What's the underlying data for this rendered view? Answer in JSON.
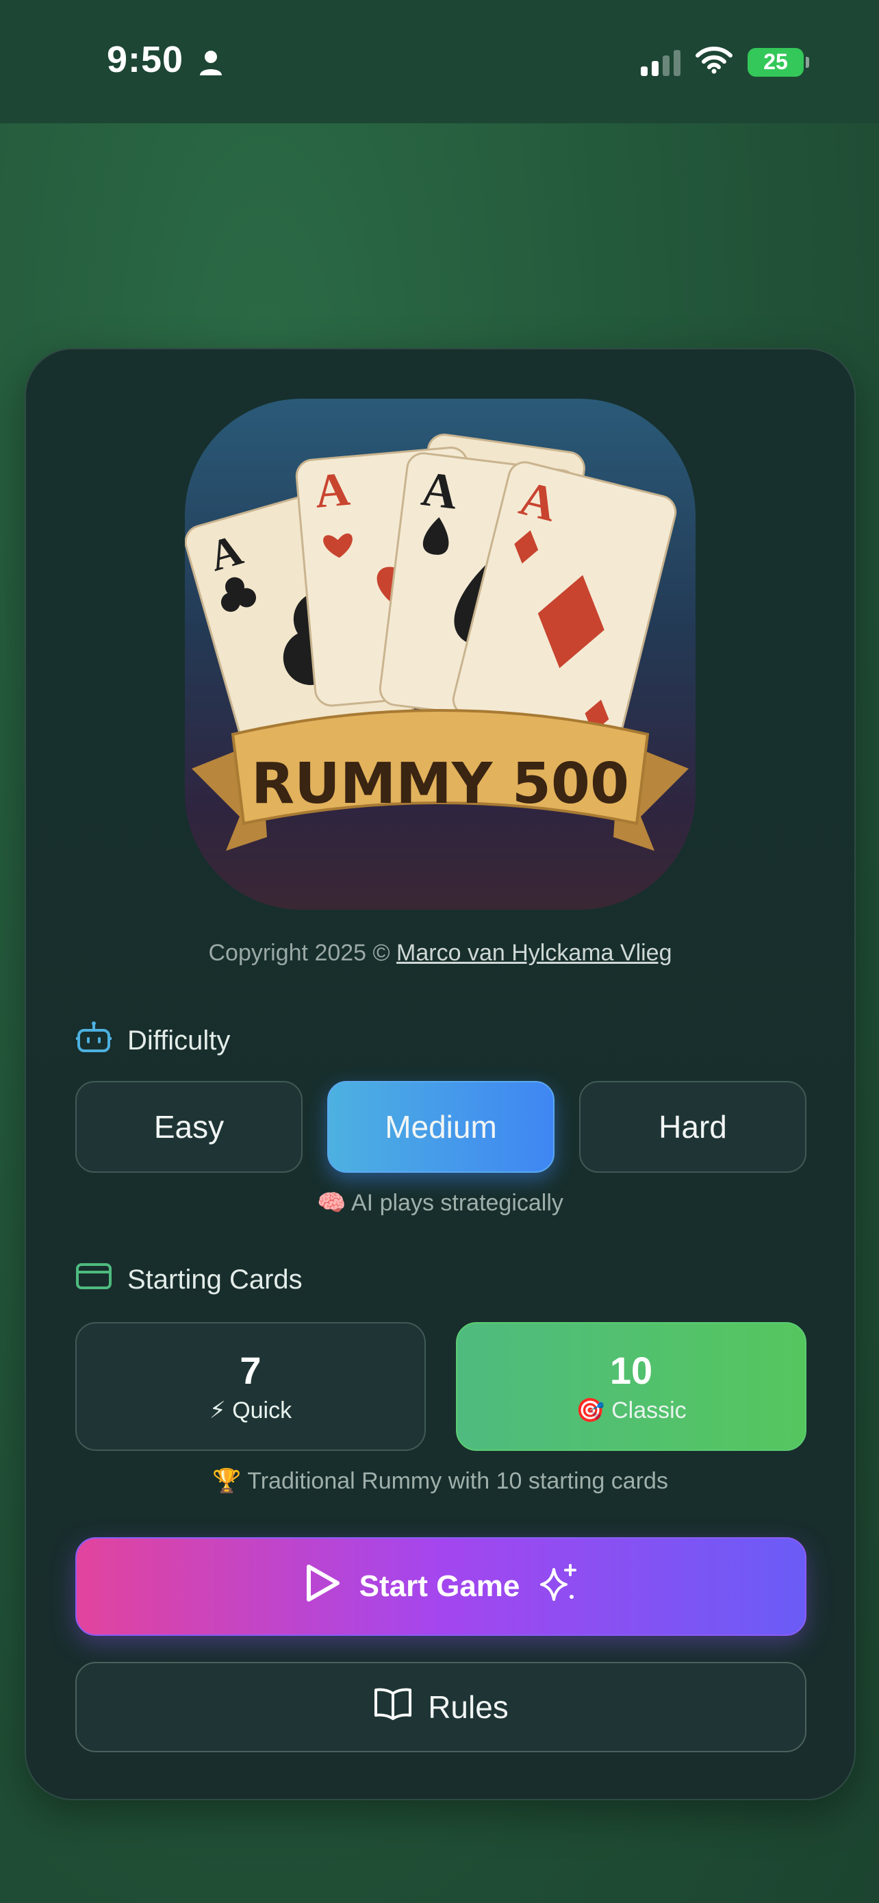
{
  "status_bar": {
    "time": "9:50",
    "battery": "25"
  },
  "logo": {
    "banner_text": "RUMMY 500",
    "card_rank": "A"
  },
  "copyright": {
    "prefix": "Copyright 2025 © ",
    "author": "Marco van Hylckama Vlieg"
  },
  "difficulty": {
    "label": "Difficulty",
    "options": [
      "Easy",
      "Medium",
      "Hard"
    ],
    "selected": "Medium",
    "hint": "🧠 AI plays strategically"
  },
  "starting_cards": {
    "label": "Starting Cards",
    "options": [
      {
        "count": "7",
        "caption": "⚡ Quick"
      },
      {
        "count": "10",
        "caption": "🎯 Classic"
      }
    ],
    "selected": "10",
    "hint": "🏆 Traditional Rummy with 10 starting cards"
  },
  "actions": {
    "start": "Start Game",
    "rules": "Rules"
  },
  "colors": {
    "background": "#245a3c",
    "panel": "#182d2c",
    "medium_active": "#3f86f3",
    "classic_active": "#55c65e",
    "start_gradient_left": "#e2449d",
    "start_gradient_right": "#6a5cf6",
    "difficulty_icon": "#4db1e0",
    "cards_icon": "#4fbb7f"
  }
}
